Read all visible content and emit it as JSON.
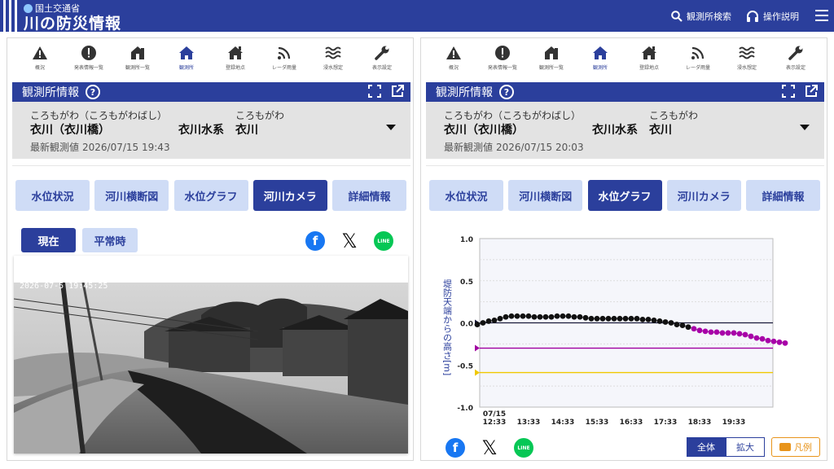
{
  "header": {
    "ministry": "国土交通省",
    "title": "川の防災情報",
    "search_label": "観測所検索",
    "help_label": "操作説明"
  },
  "iconbar": [
    {
      "icon": "warning-icon",
      "label": "概況"
    },
    {
      "icon": "alert-icon",
      "label": "発表情報一覧"
    },
    {
      "icon": "station-list-icon",
      "label": "観測所一覧"
    },
    {
      "icon": "home-icon",
      "label": "観測所"
    },
    {
      "icon": "registered-home-icon",
      "label": "登録地点"
    },
    {
      "icon": "radar-icon",
      "label": "レーダ雨量"
    },
    {
      "icon": "flood-icon",
      "label": "浸水想定"
    },
    {
      "icon": "wrench-icon",
      "label": "表示設定"
    }
  ],
  "panel_left": {
    "section_title": "観測所情報",
    "station_kana": "ころもがわ（ころもがわばし）",
    "station_name": "衣川（衣川橋）",
    "system_label": "衣川水系",
    "river_kana": "ころもがわ",
    "river_name": "衣川",
    "latest_label": "最新観測値",
    "latest_time": "2026/07/15 19:43",
    "tabs": [
      "水位状況",
      "河川横断図",
      "水位グラフ",
      "河川カメラ",
      "詳細情報"
    ],
    "active_tab": 3,
    "toggle_now": "現在",
    "toggle_normal": "平常時",
    "camera_timestamp": "2026-07-5 19:45:25"
  },
  "panel_right": {
    "section_title": "観測所情報",
    "station_kana": "ころもがわ（ころもがわばし）",
    "station_name": "衣川（衣川橋）",
    "system_label": "衣川水系",
    "river_kana": "ころもがわ",
    "river_name": "衣川",
    "latest_label": "最新観測値",
    "latest_time": "2026/07/15 20:03",
    "tabs": [
      "水位状況",
      "河川横断図",
      "水位グラフ",
      "河川カメラ",
      "詳細情報"
    ],
    "active_tab": 2,
    "zoom_all": "全体",
    "zoom_big": "拡大",
    "legend_label": "凡例"
  },
  "chart_data": {
    "type": "line",
    "ylabel": "堤防天端からの高さ[m]",
    "ylim": [
      -1.0,
      1.0
    ],
    "yticks": [
      "1.0",
      "0.5",
      "0.0",
      "-0.5",
      "-1.0"
    ],
    "xticks": [
      "07/15\n12:33",
      "13:33",
      "14:33",
      "15:33",
      "16:33",
      "17:33",
      "18:33",
      "19:33"
    ],
    "reference_lines": [
      {
        "value": 0.0,
        "color": "#1a1a3a"
      },
      {
        "value": -0.3,
        "color": "#a000a0"
      },
      {
        "value": -0.59,
        "color": "#f0c800"
      }
    ],
    "series": [
      {
        "color_observed": "#111111",
        "color_recent": "#a800a8",
        "x_start": "12:03",
        "interval_minutes": 10,
        "recent_from_index": 38,
        "values": [
          -0.02,
          0.0,
          0.02,
          0.03,
          0.05,
          0.07,
          0.08,
          0.08,
          0.08,
          0.08,
          0.07,
          0.07,
          0.07,
          0.07,
          0.08,
          0.08,
          0.08,
          0.07,
          0.07,
          0.06,
          0.05,
          0.05,
          0.05,
          0.05,
          0.05,
          0.05,
          0.05,
          0.05,
          0.05,
          0.04,
          0.04,
          0.03,
          0.02,
          0.01,
          0.0,
          -0.02,
          -0.03,
          -0.05,
          -0.07,
          -0.09,
          -0.1,
          -0.11,
          -0.11,
          -0.12,
          -0.12,
          -0.12,
          -0.13,
          -0.14,
          -0.16,
          -0.18,
          -0.19,
          -0.21,
          -0.22,
          -0.23,
          -0.24
        ]
      }
    ]
  }
}
